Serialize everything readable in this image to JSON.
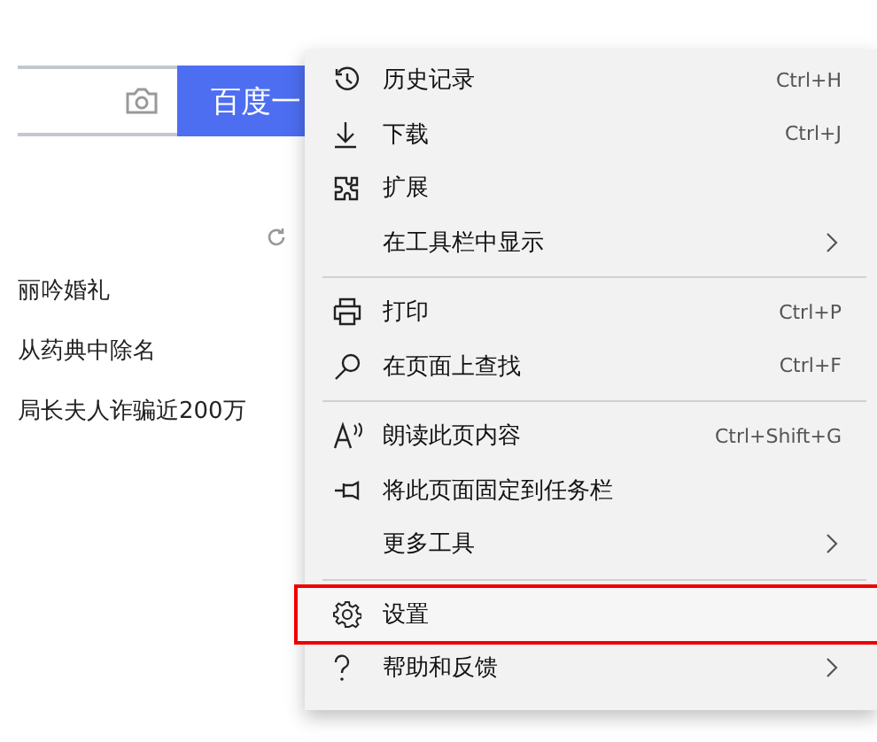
{
  "search": {
    "button": "百度一"
  },
  "news": [
    "丽吟婚礼",
    "从药典中除名",
    "局长夫人诈骗近200万"
  ],
  "menu": {
    "items": [
      {
        "kind": "item",
        "label": "历史记录",
        "shortcut": "Ctrl+H",
        "submenu": false,
        "highlighted": false
      },
      {
        "kind": "item",
        "label": "下载",
        "shortcut": "Ctrl+J",
        "submenu": false,
        "highlighted": false
      },
      {
        "kind": "item",
        "label": "扩展",
        "submenu": false,
        "highlighted": false
      },
      {
        "kind": "item",
        "label": "在工具栏中显示",
        "submenu": true,
        "highlighted": false
      },
      {
        "kind": "divider"
      },
      {
        "kind": "item",
        "label": "打印",
        "shortcut": "Ctrl+P",
        "submenu": false,
        "highlighted": false
      },
      {
        "kind": "item",
        "label": "在页面上查找",
        "shortcut": "Ctrl+F",
        "submenu": false,
        "highlighted": false
      },
      {
        "kind": "divider"
      },
      {
        "kind": "item",
        "label": "朗读此页内容",
        "shortcut": "Ctrl+Shift+G",
        "submenu": false,
        "highlighted": false
      },
      {
        "kind": "item",
        "label": "将此页面固定到任务栏",
        "submenu": false,
        "highlighted": false
      },
      {
        "kind": "item",
        "label": "更多工具",
        "submenu": true,
        "highlighted": false
      },
      {
        "kind": "divider"
      },
      {
        "kind": "item",
        "label": "设置",
        "submenu": false,
        "highlighted": true
      },
      {
        "kind": "item",
        "label": "帮助和反馈",
        "submenu": true,
        "highlighted": false
      }
    ]
  }
}
